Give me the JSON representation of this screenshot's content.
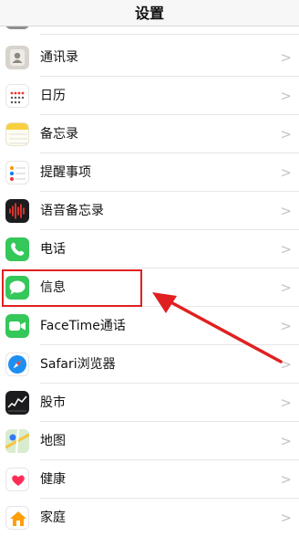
{
  "header": {
    "title": "设置"
  },
  "settings": {
    "items": [
      {
        "label": "通讯录",
        "icon": "contacts-icon"
      },
      {
        "label": "日历",
        "icon": "calendar-icon"
      },
      {
        "label": "备忘录",
        "icon": "notes-icon"
      },
      {
        "label": "提醒事项",
        "icon": "reminders-icon"
      },
      {
        "label": "语音备忘录",
        "icon": "voice-memos-icon"
      },
      {
        "label": "电话",
        "icon": "phone-icon"
      },
      {
        "label": "信息",
        "icon": "messages-icon"
      },
      {
        "label": "FaceTime通话",
        "icon": "facetime-icon"
      },
      {
        "label": "Safari浏览器",
        "icon": "safari-icon"
      },
      {
        "label": "股市",
        "icon": "stocks-icon"
      },
      {
        "label": "地图",
        "icon": "maps-icon"
      },
      {
        "label": "健康",
        "icon": "health-icon"
      },
      {
        "label": "家庭",
        "icon": "home-icon"
      }
    ],
    "chevron": ">"
  },
  "annotation": {
    "color": "#e02020",
    "target": "信息"
  }
}
